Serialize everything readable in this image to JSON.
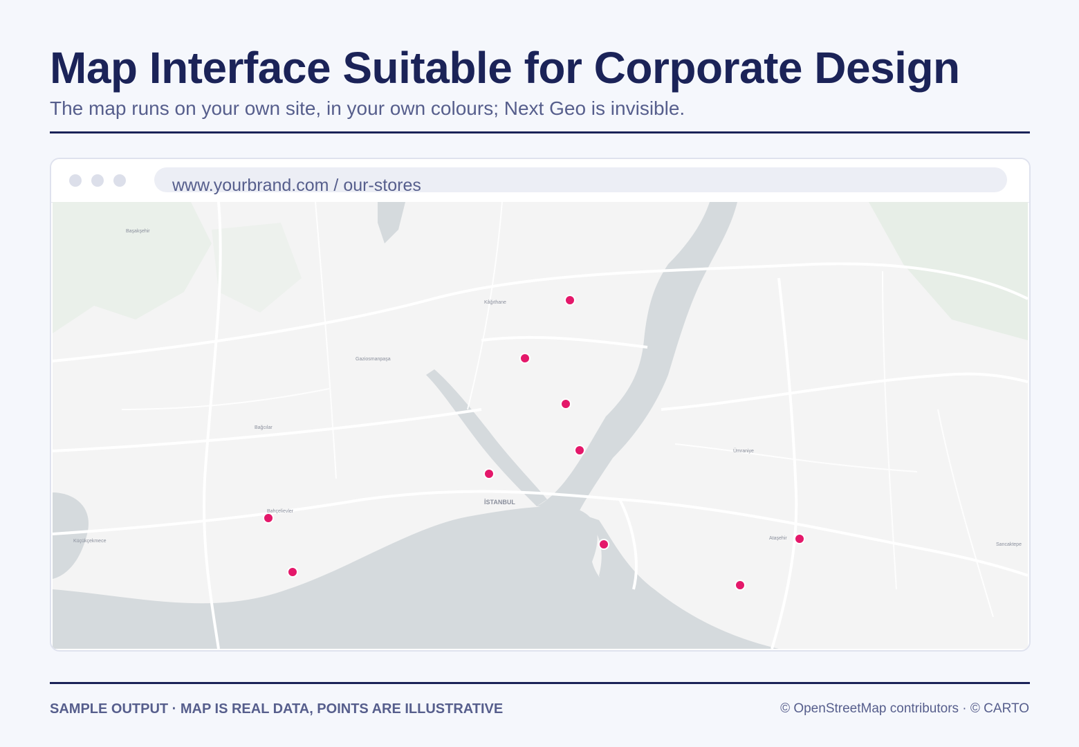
{
  "header": {
    "title": "Map Interface Suitable for Corporate Design",
    "subtitle": "The map runs on your own site, in your own colours; Next Geo is invisible."
  },
  "browser": {
    "url": "www.yourbrand.com / our-stores"
  },
  "map": {
    "city_label": "İSTANBUL",
    "district_labels": [
      {
        "id": "basaksehir",
        "text": "Başakşehir"
      },
      {
        "id": "kagithane",
        "text": "Kâğıthane"
      },
      {
        "id": "gaziosmanpasa",
        "text": "Gaziosmanpaşa"
      },
      {
        "id": "bagcilar",
        "text": "Bağcılar"
      },
      {
        "id": "bahcelievler",
        "text": "Bahçelievler"
      },
      {
        "id": "kucukcekmece",
        "text": "Küçükçekmece"
      },
      {
        "id": "umraniye",
        "text": "Ümraniye"
      },
      {
        "id": "atasehir",
        "text": "Ataşehir"
      },
      {
        "id": "sancaktepe",
        "text": "Sancaktepe"
      }
    ],
    "point_color": "#e4186a",
    "point_count": 11
  },
  "footer": {
    "note": "SAMPLE OUTPUT · MAP IS REAL DATA, POINTS ARE ILLUSTRATIVE",
    "attribution": "© OpenStreetMap contributors · © CARTO"
  }
}
